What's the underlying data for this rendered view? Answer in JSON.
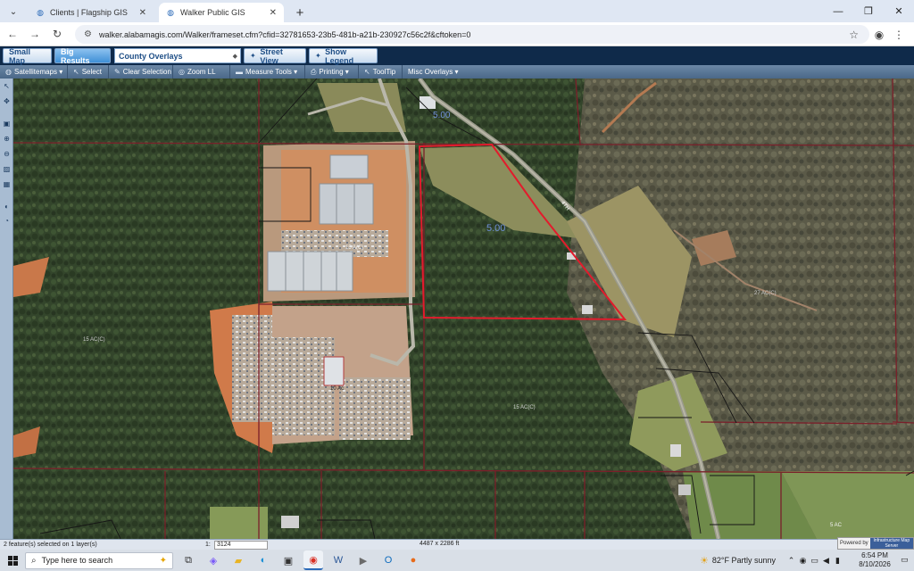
{
  "browser": {
    "tabs": [
      {
        "title": "Clients | Flagship GIS",
        "active": false
      },
      {
        "title": "Walker Public GIS",
        "active": true
      }
    ],
    "url": "walker.alabamagis.com/Walker/frameset.cfm?cfid=32781653-23b5-481b-a21b-230927c56c2f&cftoken=0"
  },
  "gis_toolbar": {
    "small_map": "Small Map",
    "big_results": "Big Results",
    "overlay_select": "County Overlays",
    "street_view": "Street View",
    "show_legend": "Show Legend"
  },
  "tools": {
    "satellitemaps": "Satellitemaps ▾",
    "select": "Select",
    "clear_selection": "Clear Selection",
    "zoom_ll": "Zoom LL",
    "measure_tools": "Measure Tools ▾",
    "printing": "Printing ▾",
    "tooltip": "ToolTip",
    "misc_overlays": "Misc Overlays ▾"
  },
  "map": {
    "labels": {
      "acres_selected": "5.00",
      "acres_ne": "5.00",
      "lbl_west": "15 AC(C)",
      "lbl_center": "10 Ac",
      "lbl_south": "15 AC(C)",
      "lbl_east": "27 AC(C)",
      "lbl_yard": "15 A(C)",
      "lbl_bottom_right": "5 AC",
      "lbl_road": "4TH"
    }
  },
  "status": {
    "selection": "2 feature(s) selected on 1 layer(s)",
    "scale_label": "1:",
    "scale_value": "3124",
    "dimensions": "4487 x 2286 ft",
    "powered_by": "Powered by",
    "powered_brand": "Infrastructure Map Server"
  },
  "taskbar": {
    "search_placeholder": "Type here to search",
    "weather_temp": "82°F",
    "weather_desc": "Partly sunny",
    "time": "6:54 PM",
    "date": "8/10/2026"
  }
}
